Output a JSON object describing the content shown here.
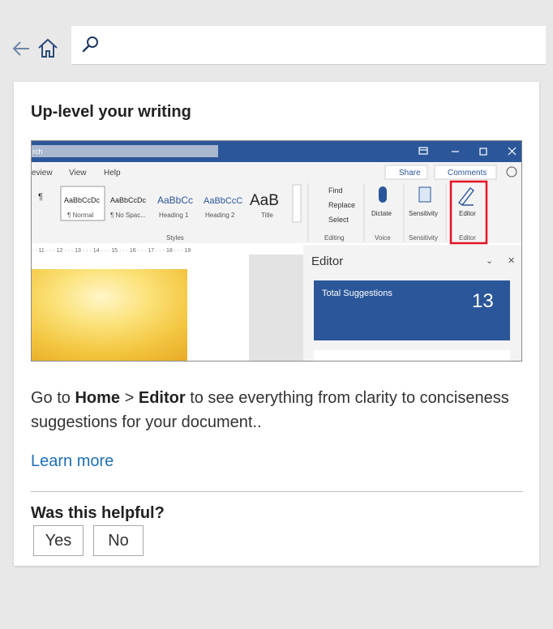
{
  "nav": {
    "back_icon": "arrow-left-icon",
    "home_icon": "home-icon"
  },
  "search": {
    "icon": "search-icon",
    "value": "",
    "placeholder": ""
  },
  "card": {
    "title": "Up-level your writing",
    "description_prefix": "Go to ",
    "description_home": "Home",
    "description_separator": " > ",
    "description_editor": "Editor",
    "description_suffix": " to see everything from clarity to conciseness suggestions for your document..",
    "learn_more": "Learn more",
    "helpful_question": "Was this helpful?",
    "yes_label": "Yes",
    "no_label": "No"
  },
  "screenshot": {
    "title_fragment": "rch",
    "tabs": [
      "eview",
      "View",
      "Help"
    ],
    "share_label": "Share",
    "comments_label": "Comments",
    "style_sample": "AaBbCcDc",
    "styles": [
      {
        "sample": "AaBbCcDc",
        "name": "¶ Normal"
      },
      {
        "sample": "AaBbCcDc",
        "name": "¶ No Spac..."
      },
      {
        "sample": "AaBbCc",
        "name": "Heading 1"
      },
      {
        "sample": "AaBbCcC",
        "name": "Heading 2"
      },
      {
        "sample": "AaB",
        "name": "Title"
      }
    ],
    "styles_group": "Styles",
    "find_label": "Find",
    "replace_label": "Replace",
    "select_label": "Select",
    "editing_group": "Editing",
    "dictate_label": "Dictate",
    "voice_group": "Voice",
    "sensitivity_label": "Sensitivity",
    "sensitivity_group": "Sensitivity",
    "editor_label": "Editor",
    "editor_group": "Editor",
    "ruler_text": "· · 11 · · · 12 · · · 13 · · · 14 · · · 15 · · · 16 · · · 17 · · · 18 · · · 19",
    "pane_title": "Editor",
    "suggestions_label": "Total Suggestions",
    "suggestions_count": "13",
    "colors": {
      "title_bar": "#2b579a",
      "highlight": "#e81123",
      "accent_blue": "#2b579a"
    }
  }
}
